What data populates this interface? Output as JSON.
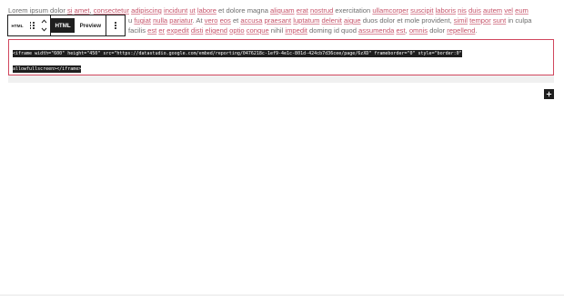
{
  "paragraph": {
    "line1": [
      {
        "t": "Lorem ipsum dolor ",
        "u": false
      },
      {
        "t": "si",
        "u": true
      },
      {
        "t": " ",
        "u": false
      },
      {
        "t": "amet",
        "u": true
      },
      {
        "t": ", ",
        "u": false
      },
      {
        "t": "consectetur",
        "u": true
      },
      {
        "t": " ",
        "u": false
      },
      {
        "t": "adipiscing",
        "u": true
      },
      {
        "t": " ",
        "u": false
      },
      {
        "t": "incidunt",
        "u": true
      },
      {
        "t": " ",
        "u": false
      },
      {
        "t": "ut",
        "u": true
      },
      {
        "t": " ",
        "u": false
      },
      {
        "t": "labore",
        "u": true
      },
      {
        "t": " et dolore magna ",
        "u": false
      },
      {
        "t": "aliquam",
        "u": true
      },
      {
        "t": " ",
        "u": false
      },
      {
        "t": "erat",
        "u": true
      },
      {
        "t": " ",
        "u": false
      },
      {
        "t": "nostrud",
        "u": true
      },
      {
        "t": " exercitation ",
        "u": false
      },
      {
        "t": "ullamcorper",
        "u": true
      },
      {
        "t": " ",
        "u": false
      },
      {
        "t": "suscipit",
        "u": true
      },
      {
        "t": " ",
        "u": false
      },
      {
        "t": "laboris",
        "u": true
      },
      {
        "t": " ",
        "u": false
      },
      {
        "t": "nis",
        "u": true
      },
      {
        "t": " ",
        "u": false
      },
      {
        "t": "duis",
        "u": true
      },
      {
        "t": " ",
        "u": false
      },
      {
        "t": "autem",
        "u": true
      },
      {
        "t": " ",
        "u": false
      },
      {
        "t": "vel",
        "u": true
      },
      {
        "t": " ",
        "u": false
      },
      {
        "t": "eum",
        "u": true
      }
    ],
    "line2": [
      {
        "t": "u",
        "u": false
      },
      {
        "t": " ",
        "u": false
      },
      {
        "t": "fugiat",
        "u": true
      },
      {
        "t": " ",
        "u": false
      },
      {
        "t": "nulla",
        "u": true
      },
      {
        "t": " ",
        "u": false
      },
      {
        "t": "pariatur",
        "u": true
      },
      {
        "t": ". At ",
        "u": false
      },
      {
        "t": "vero",
        "u": true
      },
      {
        "t": " ",
        "u": false
      },
      {
        "t": "eos",
        "u": true
      },
      {
        "t": " et ",
        "u": false
      },
      {
        "t": "accusa",
        "u": true
      },
      {
        "t": " ",
        "u": false
      },
      {
        "t": "praesant",
        "u": true
      },
      {
        "t": " ",
        "u": false
      },
      {
        "t": "luptatum",
        "u": true
      },
      {
        "t": " ",
        "u": false
      },
      {
        "t": "delenit",
        "u": true
      },
      {
        "t": " ",
        "u": false
      },
      {
        "t": "aigue",
        "u": true
      },
      {
        "t": " duos dolor et mole provident, ",
        "u": false
      },
      {
        "t": "simil",
        "u": true
      },
      {
        "t": " ",
        "u": false
      },
      {
        "t": "tempor",
        "u": true
      },
      {
        "t": " ",
        "u": false
      },
      {
        "t": "sunt",
        "u": true
      },
      {
        "t": " in culpa",
        "u": false
      }
    ],
    "line3": [
      {
        "t": "facilis ",
        "u": false
      },
      {
        "t": "est",
        "u": true
      },
      {
        "t": " ",
        "u": false
      },
      {
        "t": "er",
        "u": true
      },
      {
        "t": " ",
        "u": false
      },
      {
        "t": "expedit",
        "u": true
      },
      {
        "t": " ",
        "u": false
      },
      {
        "t": "disti",
        "u": true
      },
      {
        "t": " ",
        "u": false
      },
      {
        "t": "eligend",
        "u": true
      },
      {
        "t": " ",
        "u": false
      },
      {
        "t": "optio",
        "u": true
      },
      {
        "t": " ",
        "u": false
      },
      {
        "t": "conque",
        "u": true
      },
      {
        "t": " nihil ",
        "u": false
      },
      {
        "t": "impedit",
        "u": true
      },
      {
        "t": " doming id quod ",
        "u": false
      },
      {
        "t": "assumenda",
        "u": true
      },
      {
        "t": " ",
        "u": false
      },
      {
        "t": "est",
        "u": true
      },
      {
        "t": ", ",
        "u": false
      },
      {
        "t": "omnis",
        "u": true
      },
      {
        "t": " dolor ",
        "u": false
      },
      {
        "t": "repellend",
        "u": true
      },
      {
        "t": ".",
        "u": false
      }
    ]
  },
  "toolbar": {
    "block_type_label": "HTML",
    "drag_icon": "drag-handle-icon",
    "move_up_icon": "chevron-up-icon",
    "move_down_icon": "chevron-down-icon",
    "tab_html": "HTML",
    "tab_preview": "Preview",
    "more_icon": "more-vertical-icon"
  },
  "code_block": {
    "line1": "<iframe width=\"600\" height=\"450\" src=\"https://datastudio.google.com/embed/reporting/0476218c-1ef9-4e1c-801d-424cb7d36cee/page/6zXD\" frameborder=\"0\" style=\"border:0\"",
    "line2": "allowfullscreen></iframe>",
    "border_color": "#d1475e"
  },
  "add_block": {
    "icon": "plus-icon"
  }
}
